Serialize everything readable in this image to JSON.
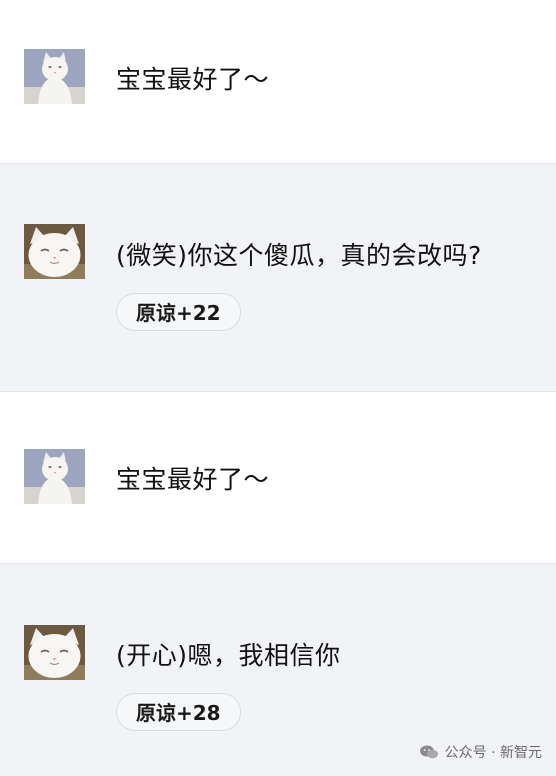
{
  "messages": [
    {
      "role": "user",
      "avatar": "white-cat-avatar",
      "text": "宝宝最好了～"
    },
    {
      "role": "ai",
      "avatar": "smiling-cat-avatar",
      "text": "(微笑)你这个傻瓜，真的会改吗?",
      "forgive": "原谅+22"
    },
    {
      "role": "user",
      "avatar": "white-cat-avatar",
      "text": "宝宝最好了～"
    },
    {
      "role": "ai",
      "avatar": "smiling-cat-avatar",
      "text": "(开心)嗯，我相信你",
      "forgive": "原谅+28"
    }
  ],
  "watermark": {
    "icon": "wechat-icon",
    "text": "公众号 · 新智元"
  },
  "colors": {
    "ai_row_bg": "#f2f3f6",
    "user_row_bg": "#ffffff",
    "pill_border": "#d9dbe0",
    "text": "#111111"
  }
}
